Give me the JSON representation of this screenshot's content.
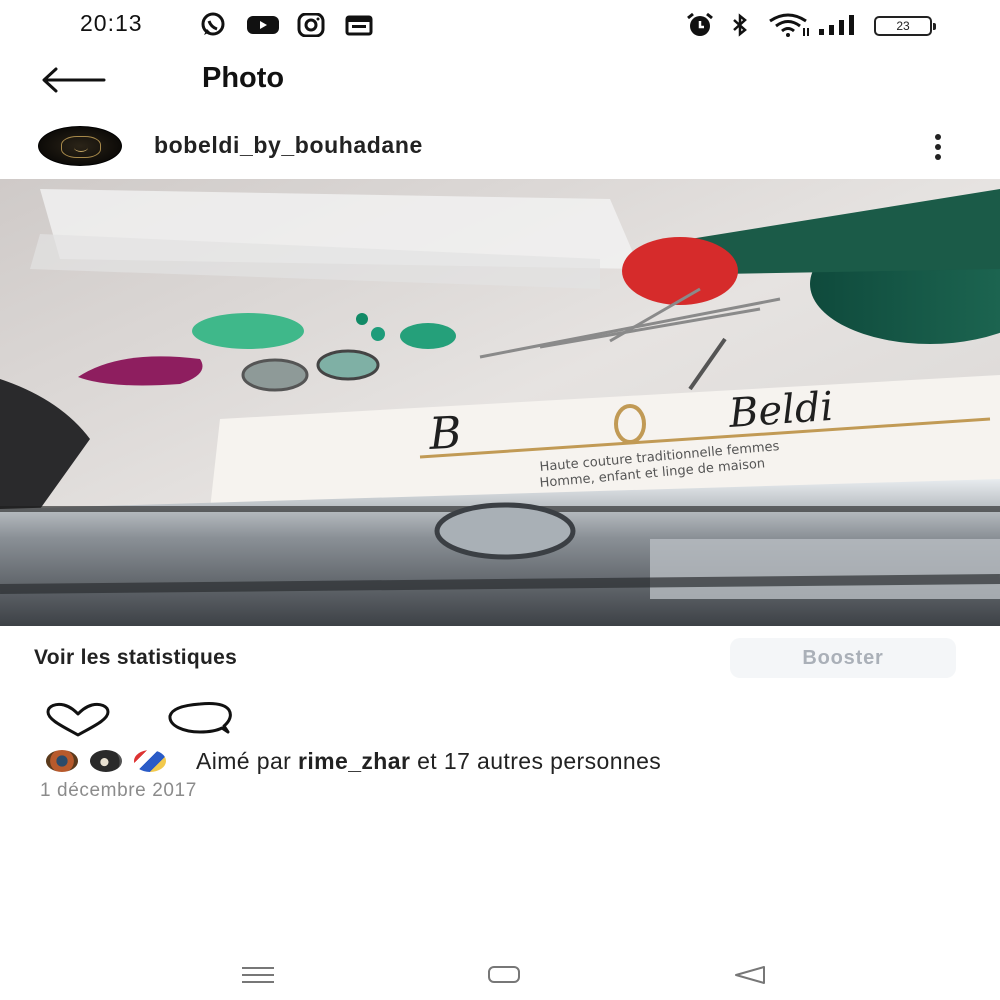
{
  "status_bar": {
    "time": "20:13",
    "battery": "23",
    "left_icons": [
      "whatsapp-icon",
      "youtube-icon",
      "instagram-icon",
      "calendar-icon"
    ],
    "right_icons": [
      "alarm-icon",
      "bluetooth-icon",
      "wifi-icon",
      "signal-icon",
      "battery-icon"
    ]
  },
  "header": {
    "title": "Photo",
    "back_icon": "arrow-left-icon"
  },
  "post": {
    "username": "bobeldi_by_bouhadane",
    "more_icon": "more-vertical-icon",
    "photo_caption_brand": "Beldi",
    "photo_caption_line1": "Haute couture traditionnelle femmes",
    "photo_caption_line2": "Homme, enfant et linge de maison"
  },
  "stats": {
    "link_label": "Voir les statistiques",
    "boost_label": "Booster"
  },
  "actions": {
    "like_icon": "heart-icon",
    "comment_icon": "comment-icon"
  },
  "likes": {
    "prefix": "Aimé par ",
    "user": "rime_zhar",
    "suffix": " et 17 autres personnes"
  },
  "date": "1 décembre 2017",
  "nav": {
    "icons": [
      "recent-apps-icon",
      "home-icon",
      "back-triangle-icon"
    ]
  },
  "colors": {
    "boost_bg": "#f4f6f8",
    "boost_text": "#aab0b8",
    "date_text": "#8b8b8b"
  }
}
